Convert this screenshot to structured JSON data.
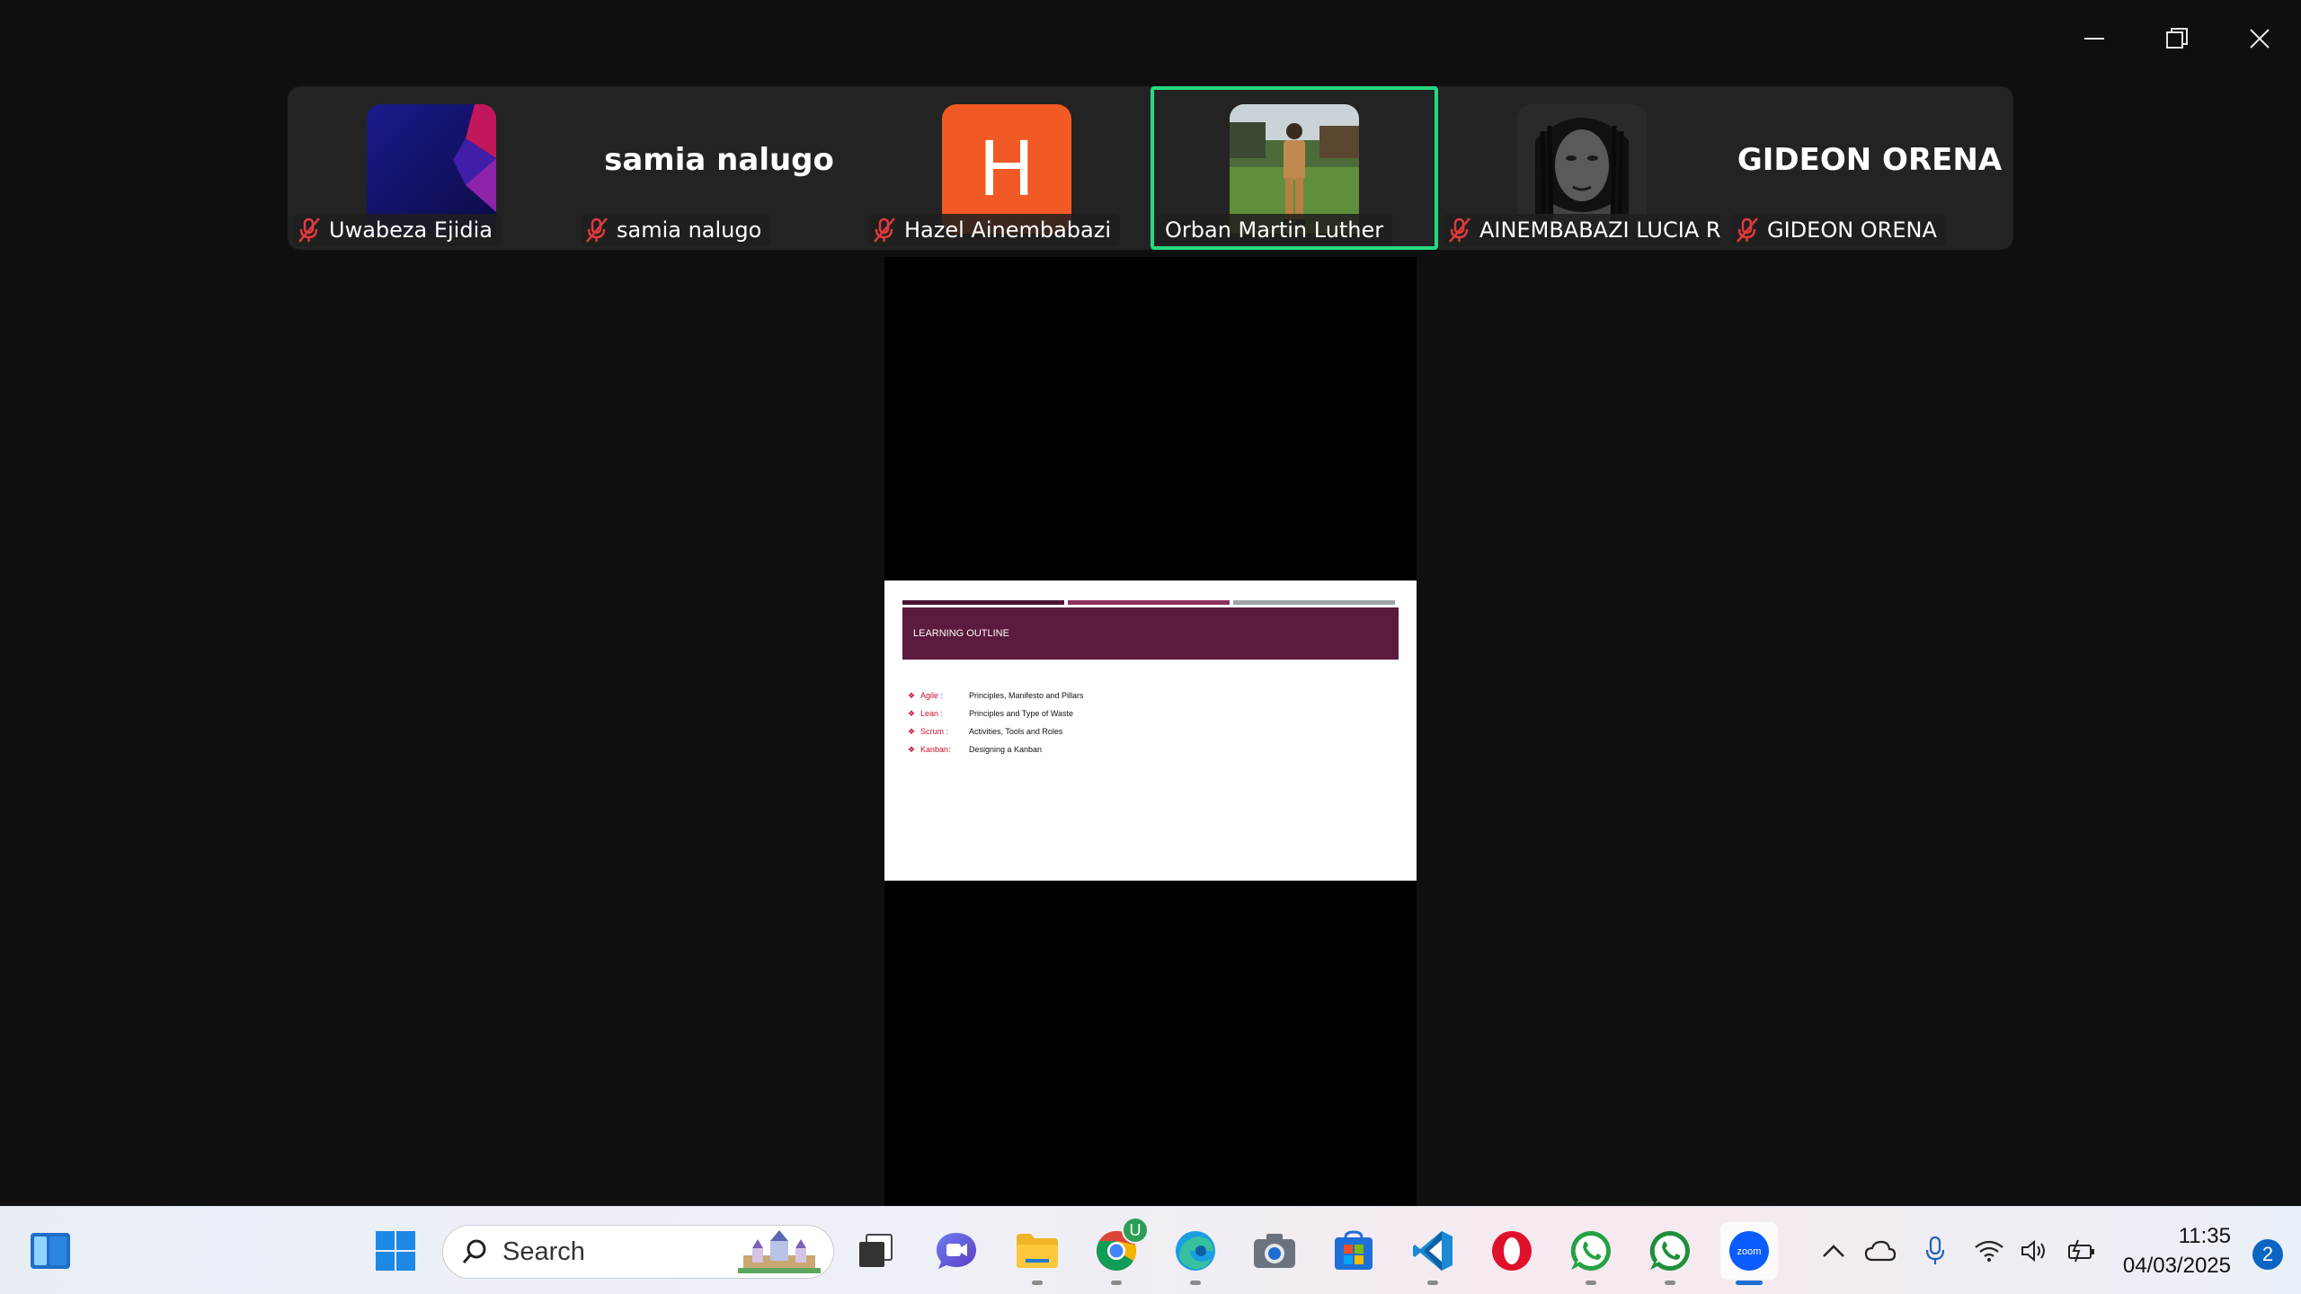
{
  "participants": [
    {
      "name": "Uwabeza Ejidia",
      "muted": true,
      "tile_type": "image"
    },
    {
      "name": "samia nalugo",
      "muted": true,
      "tile_type": "name",
      "display": "samia nalugo"
    },
    {
      "name": "Hazel Ainembabazi",
      "muted": true,
      "tile_type": "letter",
      "letter": "H"
    },
    {
      "name": "Orban Martin Luther",
      "muted": false,
      "tile_type": "image",
      "active_speaker": true
    },
    {
      "name": "AINEMBABAZI LUCIA R...",
      "muted": true,
      "tile_type": "image"
    },
    {
      "name": "GIDEON ORENA",
      "muted": true,
      "tile_type": "name",
      "display": "GIDEON ORENA"
    }
  ],
  "slide": {
    "title": "LEARNING OUTLINE",
    "items": [
      {
        "term": "Agile   :",
        "desc": "Principles, Manifesto and Pillars"
      },
      {
        "term": "Lean   :",
        "desc": "Principles  and Type of Waste"
      },
      {
        "term": "Scrum :",
        "desc": "Activities, Tools and Roles"
      },
      {
        "term": "Kanban:",
        "desc": "Designing a Kanban"
      }
    ],
    "bar_colors": [
      "#4a1232",
      "#8e2f5e",
      "#9ea3a8"
    ],
    "header_color": "#5b1a3e"
  },
  "taskbar": {
    "search_label": "Search",
    "chrome_badge": "U",
    "time": "11:35",
    "date": "04/03/2025",
    "notification_count": "2",
    "apps": [
      "widgets",
      "start",
      "task-view",
      "teams",
      "file-explorer",
      "chrome",
      "edge",
      "camera",
      "microsoft-store",
      "vscode",
      "opera",
      "whatsapp",
      "whatsapp-business",
      "zoom"
    ]
  },
  "colors": {
    "active_speaker_border": "#26d97f",
    "muted_icon": "#e0393e",
    "letter_avatar": "#f15a24"
  }
}
